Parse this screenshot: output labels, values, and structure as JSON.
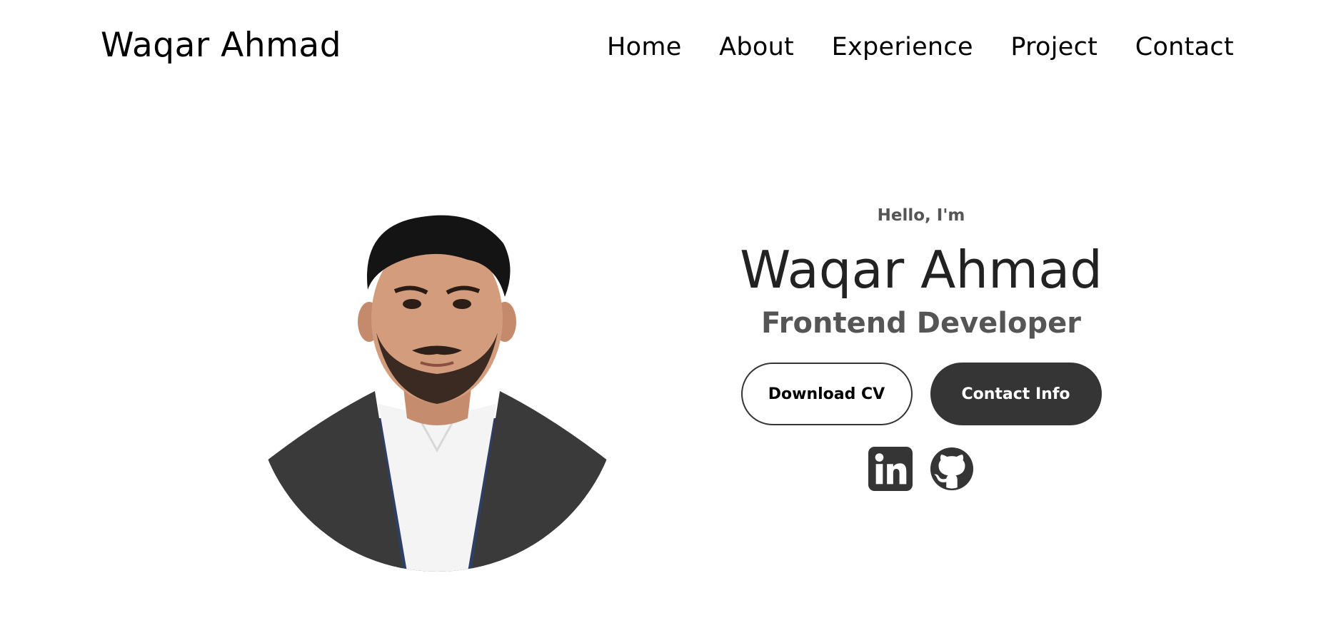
{
  "nav": {
    "logo": "Waqar Ahmad",
    "links": [
      "Home",
      "About",
      "Experience",
      "Project",
      "Contact"
    ]
  },
  "hero": {
    "greeting": "Hello, I'm",
    "name": "Waqar Ahmad",
    "title": "Frontend Developer",
    "download_cv_label": "Download CV",
    "contact_info_label": "Contact Info",
    "socials": [
      {
        "icon": "linkedin-icon"
      },
      {
        "icon": "github-icon"
      }
    ]
  },
  "colors": {
    "text_dark": "#222222",
    "text_muted": "#555555",
    "button_dark": "#353535"
  }
}
